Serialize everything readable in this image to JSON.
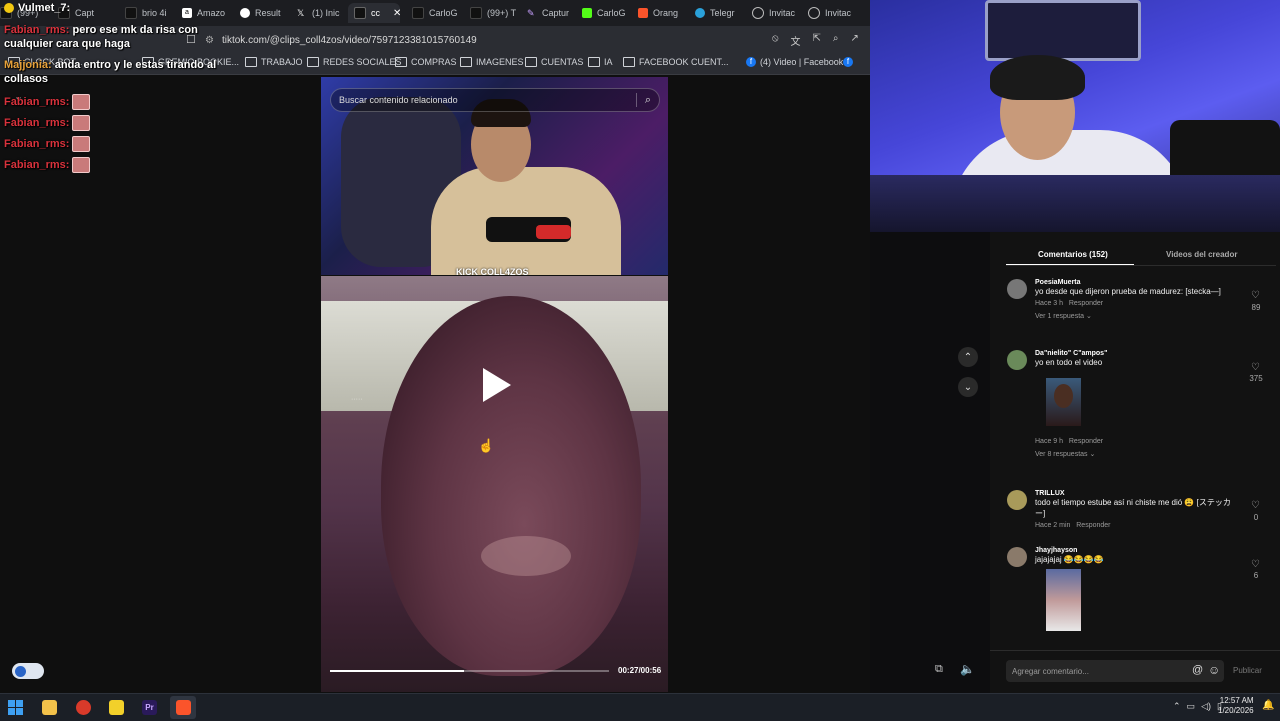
{
  "browser": {
    "tabs": [
      {
        "label": "(99+)",
        "icon": "tiktok-icon"
      },
      {
        "label": "Capt",
        "icon": "tiktok-icon"
      },
      {
        "label": "brio 4i",
        "icon": "tiktok-icon"
      },
      {
        "label": "Amazo",
        "icon": "amazon-icon"
      },
      {
        "label": "Result",
        "icon": "google-icon"
      },
      {
        "label": "(1) Inic",
        "icon": "x-icon"
      },
      {
        "label": "cc",
        "icon": "tiktok-icon",
        "active": true
      },
      {
        "label": "CarloG",
        "icon": "tiktok-icon"
      },
      {
        "label": "(99+) T",
        "icon": "tiktok-icon"
      },
      {
        "label": "Captur",
        "icon": "feather-icon"
      },
      {
        "label": "CarloG",
        "icon": "kick-icon"
      },
      {
        "label": "Orang",
        "icon": "brave-icon"
      },
      {
        "label": "Telegr",
        "icon": "telegram-icon"
      },
      {
        "label": "Invitac",
        "icon": "globe-icon"
      },
      {
        "label": "Invitac",
        "icon": "globe-icon"
      }
    ],
    "url": "tiktok.com/@clips_coll4zos/video/7597123381015760149",
    "bookmarks": [
      {
        "label": "CLOCK BOT...",
        "icon": "folder-icon"
      },
      {
        "label": "GREMIO BOOKIE...",
        "icon": "folder-icon"
      },
      {
        "label": "TRABAJO",
        "icon": "folder-icon"
      },
      {
        "label": "REDES SOCIALES",
        "icon": "folder-icon"
      },
      {
        "label": "COMPRAS",
        "icon": "folder-icon"
      },
      {
        "label": "IMAGENES",
        "icon": "folder-icon"
      },
      {
        "label": "CUENTAS",
        "icon": "folder-icon"
      },
      {
        "label": "IA",
        "icon": "folder-icon"
      },
      {
        "label": "FACEBOOK CUENT...",
        "icon": "folder-icon"
      },
      {
        "label": "(4) Video | Facebook",
        "icon": "facebook-icon"
      }
    ]
  },
  "chat_overlay": {
    "header_user": "Vulmet_7:",
    "messages": [
      {
        "user": "Fabian_rms:",
        "text": "pero ese mk da risa con cualquier cara que haga",
        "user_color": "red"
      },
      {
        "user": "Majjonia:",
        "text": "anda entro y le estas tirando al collasos",
        "user_color": "orange"
      },
      {
        "user": "Fabian_rms:",
        "text": "",
        "user_color": "red",
        "emote": true
      },
      {
        "user": "Fabian_rms:",
        "text": "",
        "user_color": "red",
        "emote": true
      },
      {
        "user": "Fabian_rms:",
        "text": "",
        "user_color": "red",
        "emote": true
      },
      {
        "user": "Fabian_rms:",
        "text": "",
        "user_color": "red",
        "emote": true
      }
    ]
  },
  "video": {
    "search_placeholder": "Buscar contenido relacionado",
    "kick_watermark": "KICK COLL4ZOS",
    "time": "00:27/00:56",
    "progress": 0.48
  },
  "comments": {
    "tabs": [
      "Comentarios (152)",
      "Videos del creador"
    ],
    "items": [
      {
        "user": "PoesiaMuerta",
        "text": "yo desde que dijeron prueba de madurez: [stecka—]",
        "time": "Hace 3 h",
        "reply": "Responder",
        "replies": "Ver 1 respuesta",
        "likes": "89",
        "avatar_color": "#777"
      },
      {
        "user": "Da\"nielito\" C\"ampos\"",
        "text": "yo en todo el video",
        "time": "Hace 9 h",
        "reply": "Responder",
        "replies": "Ver 8 respuestas",
        "likes": "375",
        "avatar_color": "#6a8a5a"
      },
      {
        "user": "TRILLUX",
        "text": "todo el tiempo estube así ni chiste me dió 😩 [ステッカー]",
        "time": "Hace 2 min",
        "reply": "Responder",
        "replies": "",
        "likes": "0",
        "avatar_color": "#a89a5a"
      },
      {
        "user": "Jhayjhayson",
        "text": "jajajajaj 😂😂😂😂",
        "time": "",
        "reply": "",
        "replies": "",
        "likes": "6",
        "avatar_color": "#8a7a6a"
      }
    ],
    "input_placeholder": "Agregar comentario...",
    "publish": "Publicar"
  },
  "taskbar": {
    "time": "12:57 AM",
    "date": "1/20/2026"
  }
}
